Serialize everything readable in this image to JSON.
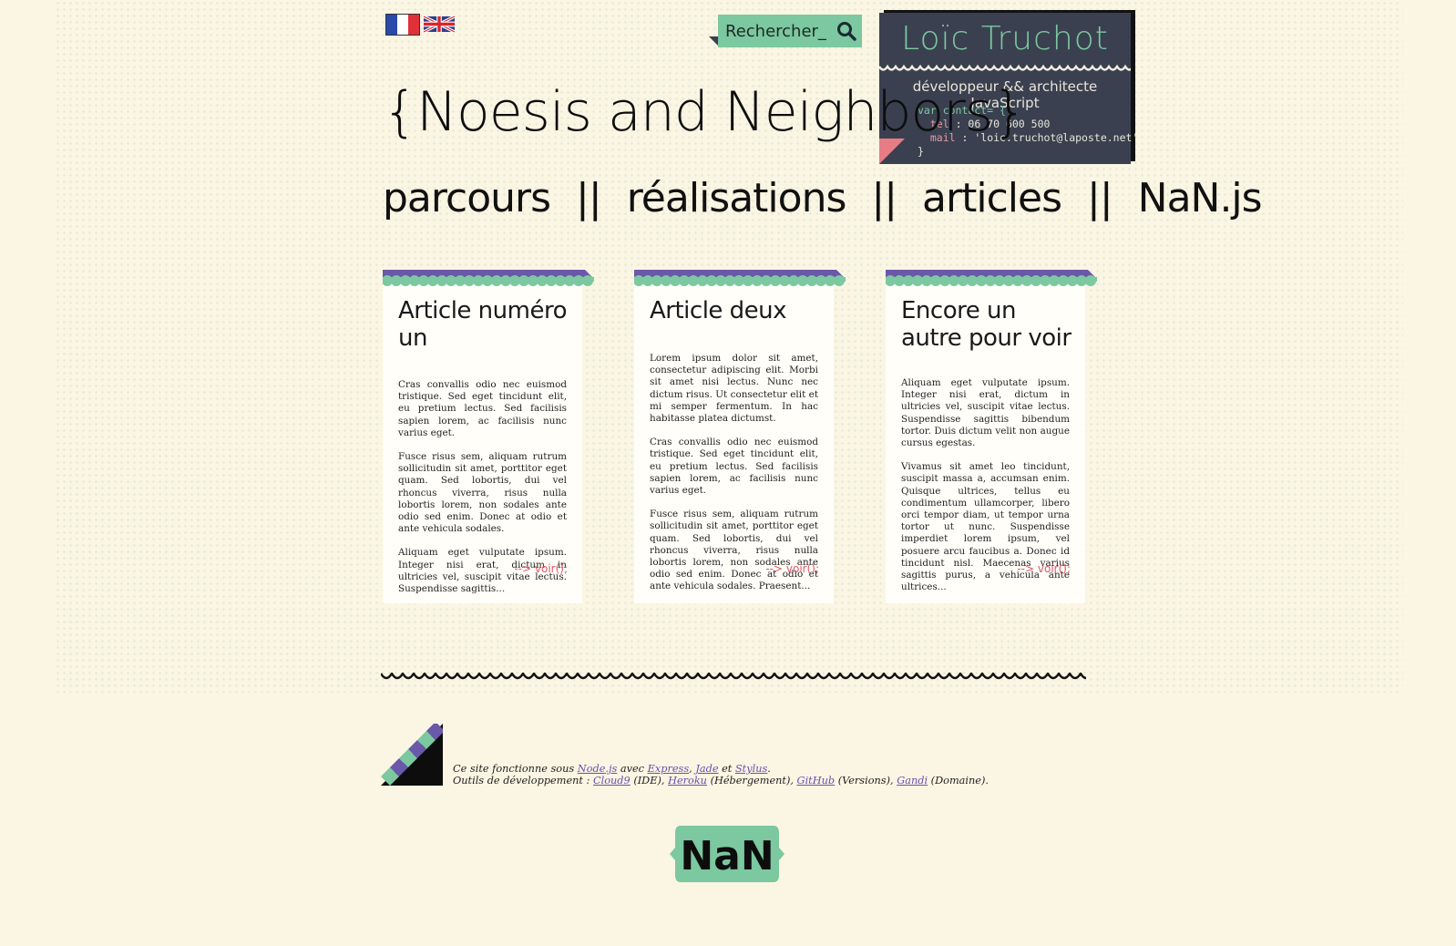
{
  "header": {
    "languages": [
      {
        "name": "fr-flag-icon",
        "label": "Français"
      },
      {
        "name": "uk-flag-icon",
        "label": "English"
      }
    ],
    "search": {
      "placeholder": "Rechercher_",
      "icon": "search-icon"
    },
    "site_title": "{Noesis and Neighbors}"
  },
  "contact_card": {
    "name": "Loïc Truchot",
    "role": "développeur && architecte JavaScript",
    "code_open": "var contact= {",
    "tel_key": "tel",
    "tel_value": "06 70 600 500",
    "mail_key": "mail",
    "mail_value": "'loic.truchot@laposte.net'",
    "code_close": "}"
  },
  "nav": {
    "items": [
      "parcours",
      "réalisations",
      "articles",
      "NaN.js"
    ],
    "separator": "||"
  },
  "articles": [
    {
      "title": "Article numéro un",
      "paragraphs": [
        "Cras convallis odio nec euismod tristique. Sed eget tincidunt elit, eu pretium lectus. Sed facilisis sapien lorem, ac facilisis nunc varius eget.",
        "Fusce risus sem, aliquam rutrum sollicitudin sit amet, porttitor eget quam. Sed lobortis, dui vel rhoncus viverra, risus nulla lobortis lorem, non sodales ante odio sed enim. Donec at odio et ante vehicula sodales.",
        "Aliquam eget vulputate ipsum. Integer nisi erat, dictum in ultricies vel, suscipit vitae lectus. Suspendisse sagittis..."
      ],
      "more": "--> voir();"
    },
    {
      "title": "Article deux",
      "paragraphs": [
        "Lorem ipsum dolor sit amet, consectetur adipiscing elit. Morbi sit amet nisi lectus. Nunc nec dictum risus. Ut consectetur elit et mi semper fermentum. In hac habitasse platea dictumst.",
        "Cras convallis odio nec euismod tristique. Sed eget tincidunt elit, eu pretium lectus. Sed facilisis sapien lorem, ac facilisis nunc varius eget.",
        "Fusce risus sem, aliquam rutrum sollicitudin sit amet, porttitor eget quam. Sed lobortis, dui vel rhoncus viverra, risus nulla lobortis lorem, non sodales ante odio sed enim. Donec at odio et ante vehicula sodales. Praesent..."
      ],
      "more": "--> voir();"
    },
    {
      "title": "Encore un autre pour voir",
      "paragraphs": [
        "Aliquam eget vulputate ipsum. Integer nisi erat, dictum in ultricies vel, suscipit vitae lectus. Suspendisse sagittis bibendum tortor. Duis dictum velit non augue cursus egestas.",
        "Vivamus sit amet leo tincidunt, suscipit massa a, accumsan enim. Quisque ultrices, tellus eu condimentum ullamcorper, libero orci tempor diam, ut tempor urna tortor ut nunc. Suspendisse imperdiet lorem ipsum, vel posuere arcu faucibus a. Donec id tincidunt nisl. Maecenas varius sagittis purus, a vehicula ante ultrices..."
      ],
      "more": "--> voir();"
    }
  ],
  "footer": {
    "line1_prefix": "Ce site fonctionne sous",
    "nodejs": "Node.js",
    "avec": "avec",
    "express": "Express",
    "jade": "Jade",
    "et": "et",
    "stylus": "Stylus",
    "line2_prefix": "Outils de développement :",
    "cloud9": "Cloud9",
    "cloud9_note": "(IDE),",
    "heroku": "Heroku",
    "heroku_note": "(Hébergement),",
    "github": "GitHub",
    "github_note": "(Versions),",
    "gandi": "Gandi",
    "gandi_note": "(Domaine).",
    "logo_text": "NaN"
  },
  "colors": {
    "background": "#fbf5e3",
    "accent_green": "#7cc8a0",
    "accent_purple": "#6a58a8",
    "card_dark": "#3a4050",
    "link_pink": "#e05a6a"
  }
}
